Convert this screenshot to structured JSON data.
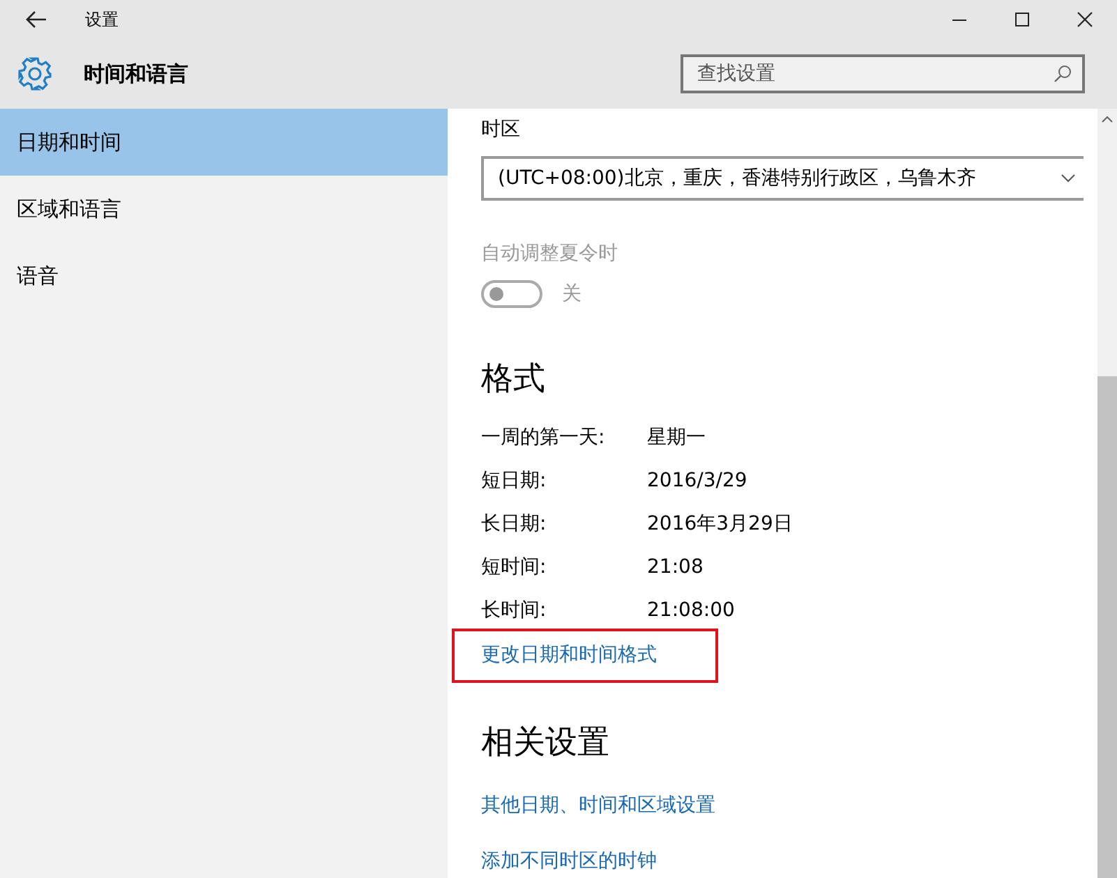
{
  "window": {
    "title": "设置"
  },
  "header": {
    "title": "时间和语言"
  },
  "search": {
    "placeholder": "查找设置"
  },
  "sidebar": {
    "items": [
      {
        "label": "日期和时间",
        "selected": true
      },
      {
        "label": "区域和语言",
        "selected": false
      },
      {
        "label": "语音",
        "selected": false
      }
    ]
  },
  "timezone": {
    "label": "时区",
    "value": "(UTC+08:00)北京，重庆，香港特别行政区，乌鲁木齐"
  },
  "dst": {
    "label": "自动调整夏令时",
    "on": false,
    "disabled": true,
    "state_text": "关"
  },
  "formats": {
    "heading": "格式",
    "rows": [
      {
        "label": "一周的第一天:",
        "value": "星期一"
      },
      {
        "label": "短日期:",
        "value": "2016/3/29"
      },
      {
        "label": "长日期:",
        "value": "2016年3月29日"
      },
      {
        "label": "短时间:",
        "value": "21:08"
      },
      {
        "label": "长时间:",
        "value": "21:08:00"
      }
    ],
    "link": {
      "text": "更改日期和时间格式",
      "highlighted": true
    }
  },
  "related": {
    "heading": "相关设置",
    "links": [
      {
        "text": "其他日期、时间和区域设置"
      },
      {
        "text": "添加不同时区的时钟"
      }
    ]
  }
}
